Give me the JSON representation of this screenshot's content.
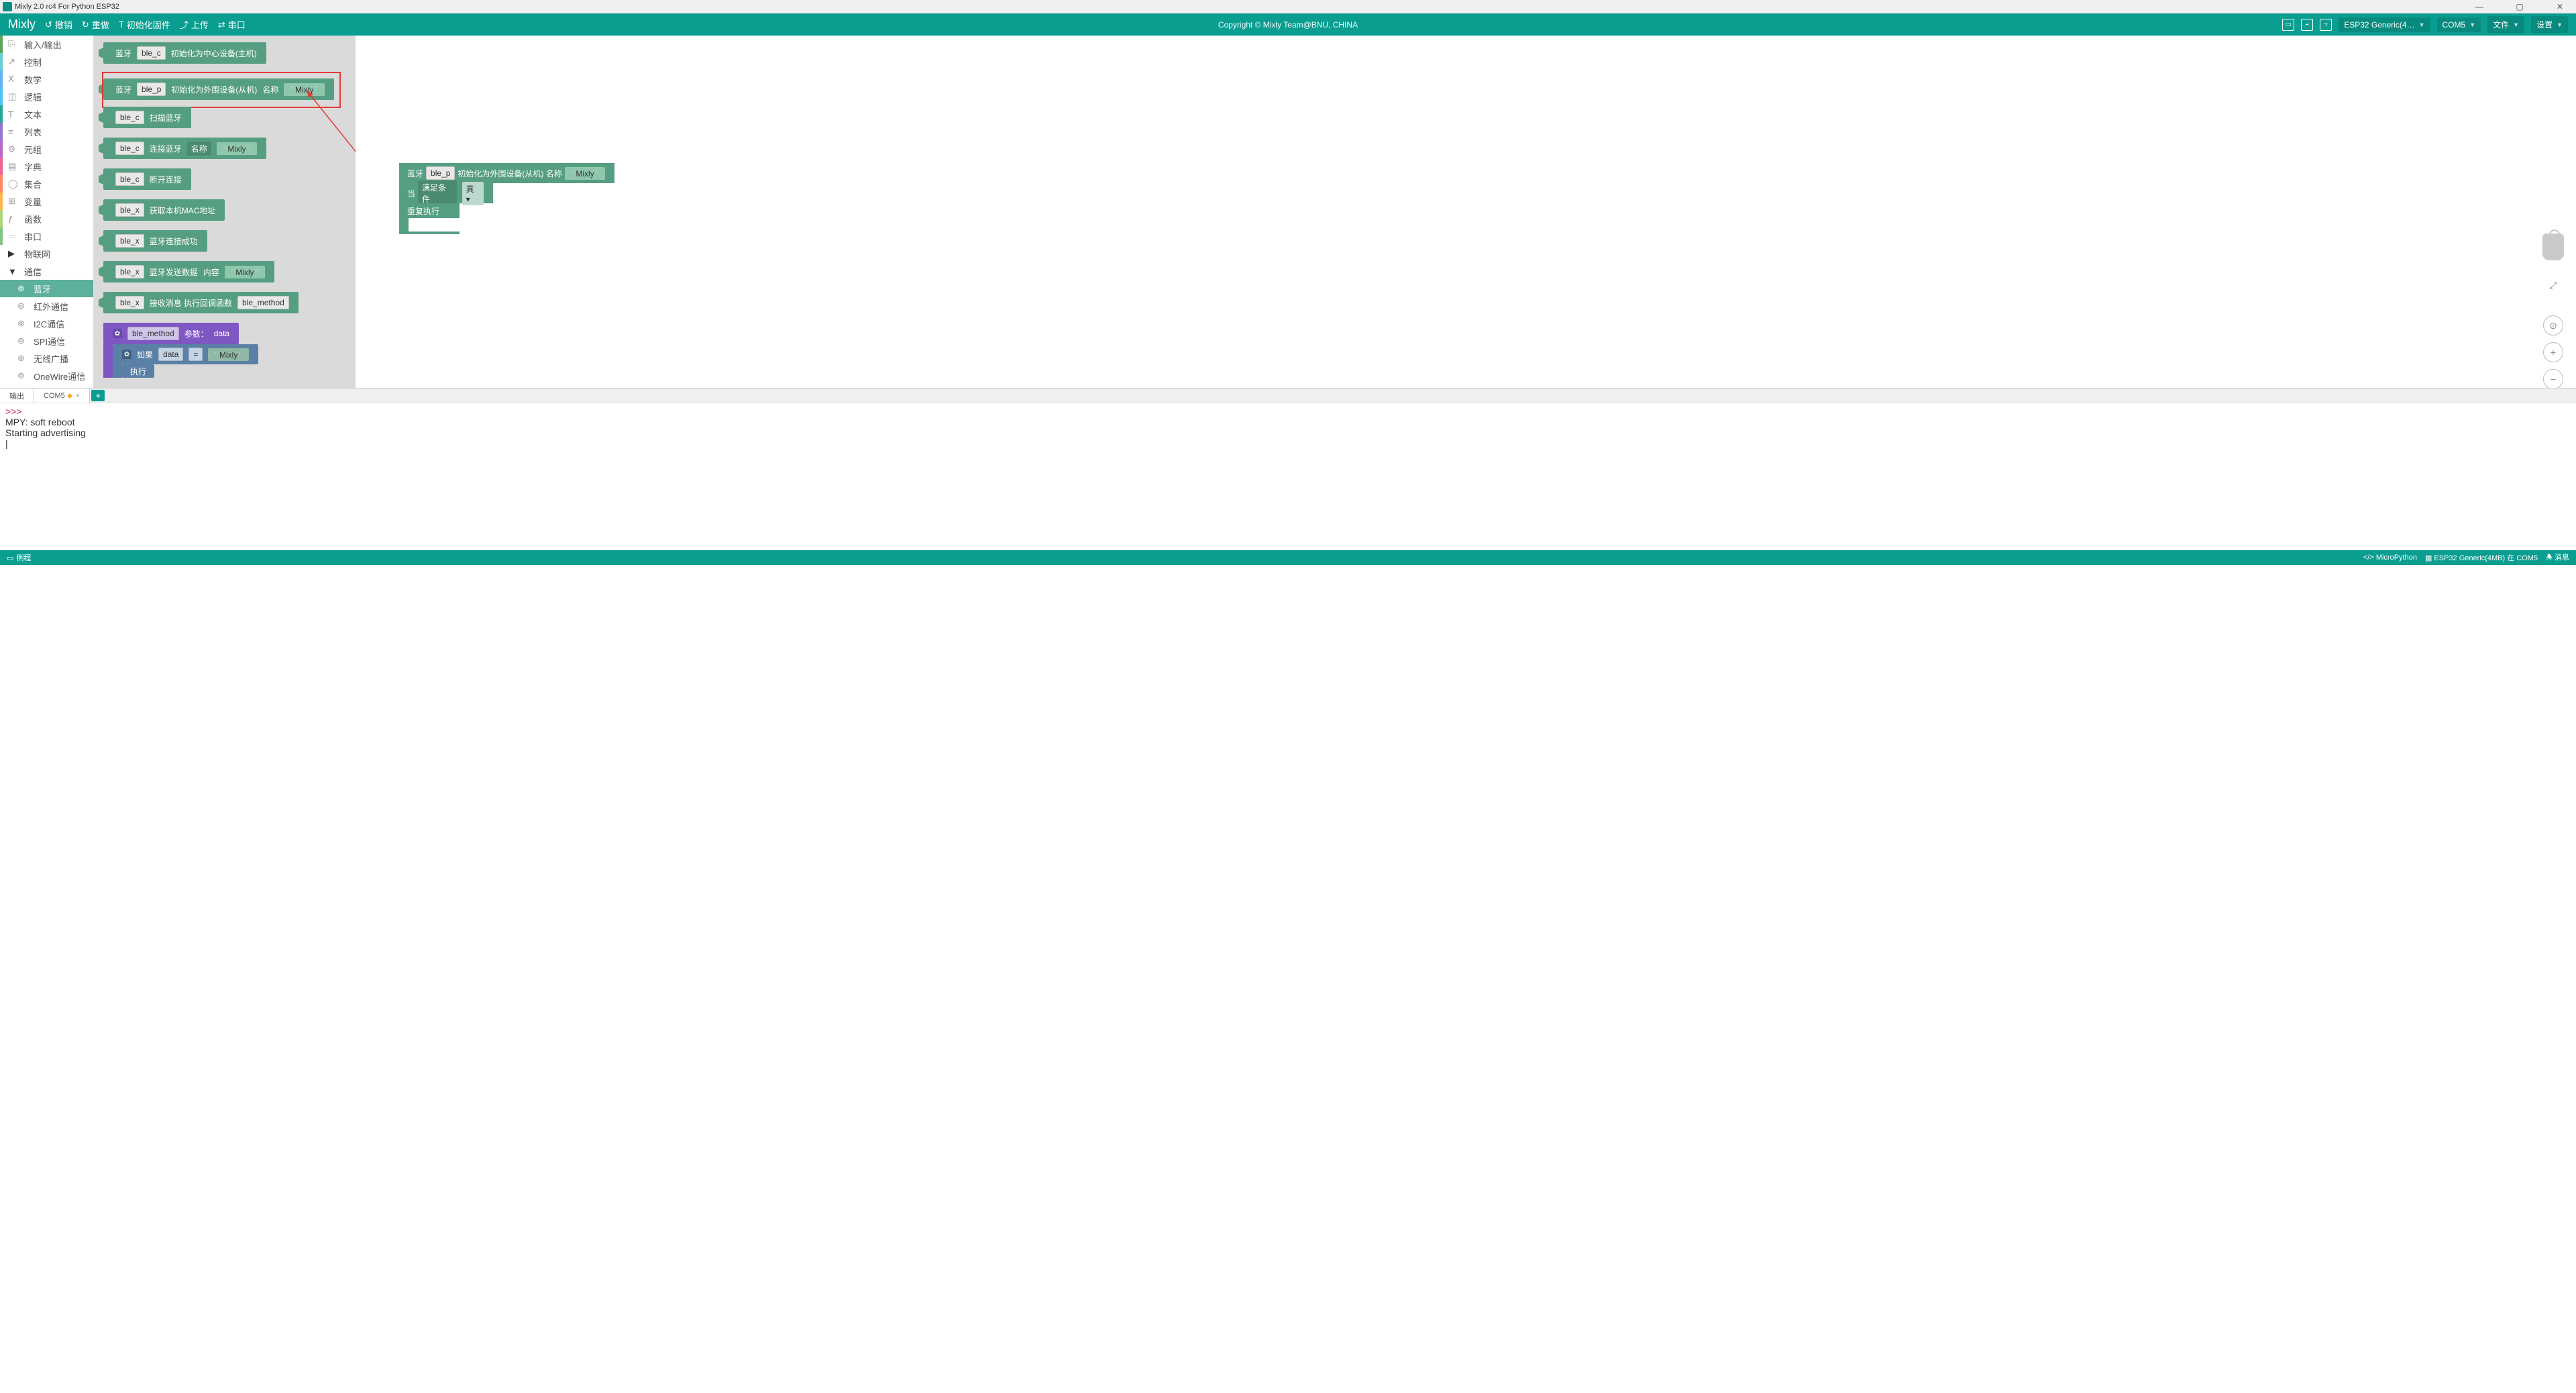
{
  "title": "Mixly 2.0 rc4 For Python ESP32",
  "menubar": {
    "logo": "Mixly",
    "undo": "撤销",
    "redo": "重做",
    "init_fw": "初始化固件",
    "upload": "上传",
    "serial": "串口",
    "copyright": "Copyright © Mixly Team@BNU, CHINA",
    "board": "ESP32 Generic(4…",
    "port": "COM5",
    "file": "文件",
    "settings": "设置"
  },
  "sidebar": {
    "cats": [
      "输入/输出",
      "控制",
      "数学",
      "逻辑",
      "文本",
      "列表",
      "元组",
      "字典",
      "集合",
      "变量",
      "函数",
      "串口"
    ],
    "iot": "物联网",
    "comm": "通信",
    "subs": [
      "蓝牙",
      "红外通信",
      "I2C通信",
      "SPI通信",
      "无线广播",
      "OneWire通信"
    ]
  },
  "flyout": {
    "b1_bt": "蓝牙",
    "b1_var": "ble_c",
    "b1_txt": "初始化为中心设备(主机)",
    "b2_bt": "蓝牙",
    "b2_var": "ble_p",
    "b2_txt": "初始化为外围设备(从机)",
    "b2_name": "名称",
    "b2_val": "Mixly",
    "b3_var": "ble_c",
    "b3_txt": "扫描蓝牙",
    "b4_var": "ble_c",
    "b4_txt": "连接蓝牙",
    "b4_name": "名称",
    "b4_val": "Mixly",
    "b5_var": "ble_c",
    "b5_txt": "断开连接",
    "b6_var": "ble_x",
    "b6_txt": "获取本机MAC地址",
    "b7_var": "ble_x",
    "b7_txt": "蓝牙连接成功",
    "b8_var": "ble_x",
    "b8_txt": "蓝牙发送数据",
    "b8_content": "内容",
    "b8_val": "Mixly",
    "b9_var": "ble_x",
    "b9_txt": "接收消息 执行回调函数",
    "b9_method": "ble_method",
    "b10_method": "ble_method",
    "b10_params": "参数：",
    "b10_data": "data",
    "b11_if": "如果",
    "b11_data": "data",
    "b11_eq": "=",
    "b11_val": "Mixly",
    "b11_do": "执行"
  },
  "canvas": {
    "r1_bt": "蓝牙",
    "r1_var": "ble_p",
    "r1_txt": "初始化为外围设备(从机)",
    "r1_name": "名称",
    "r1_val": "Mixly",
    "r2_when": "当",
    "r2_cond": "满足条件",
    "r2_true": "真",
    "r2_repeat": "重复执行"
  },
  "tabs": {
    "output": "输出",
    "port": "COM5"
  },
  "console": {
    "prompt": ">>>",
    "l1": "MPY: soft reboot",
    "l2": "Starting advertising"
  },
  "status": {
    "example": "例程",
    "lang": "MicroPython",
    "board": "ESP32 Generic(4MB) 在 COM5",
    "msg": "消息"
  }
}
